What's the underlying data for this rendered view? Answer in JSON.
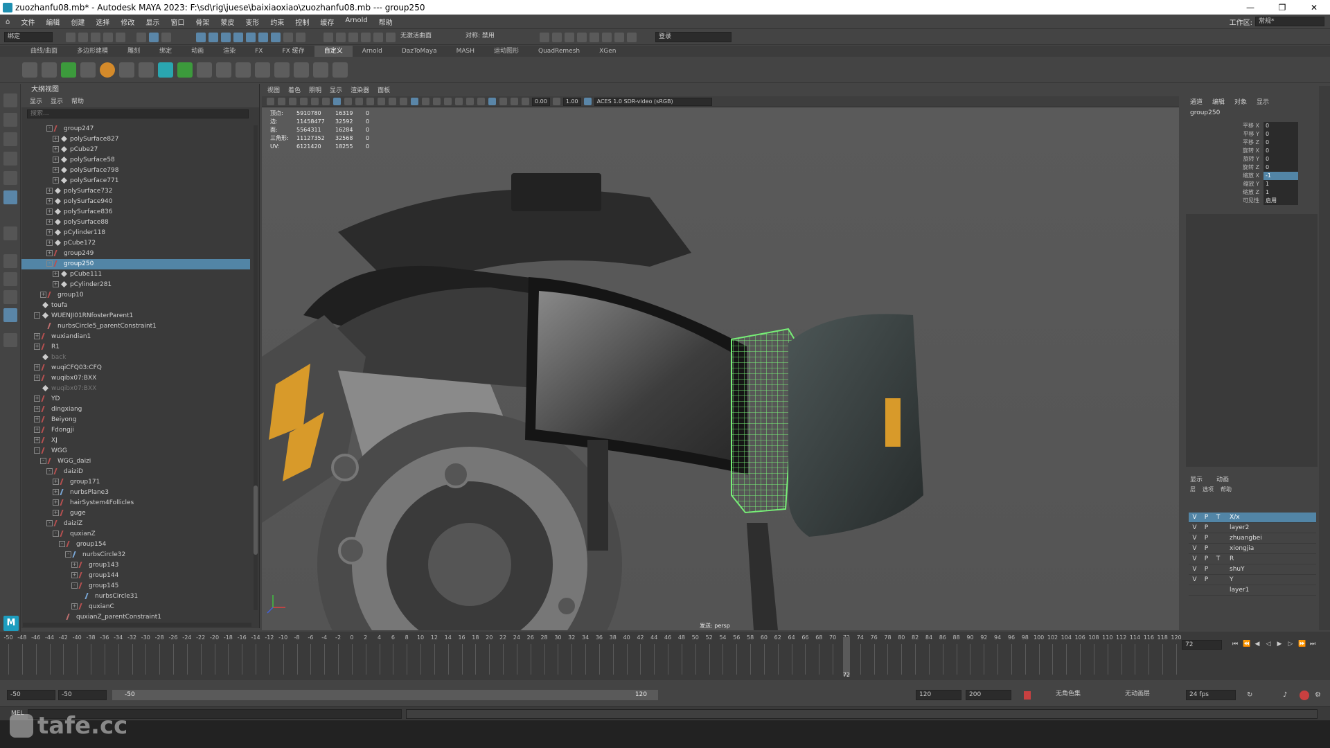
{
  "window": {
    "title": "zuozhanfu08.mb* - Autodesk MAYA 2023: F:\\sd\\rig\\juese\\baixiaoxiao\\zuozhanfu08.mb  ---  group250",
    "minimize": "—",
    "maximize": "❐",
    "close": "✕"
  },
  "menubar": {
    "items": [
      "文件",
      "编辑",
      "创建",
      "选择",
      "修改",
      "显示",
      "窗口",
      "骨架",
      "蒙皮",
      "变形",
      "约束",
      "控制",
      "缓存",
      "Arnold",
      "帮助"
    ],
    "workspace_label": "工作区:",
    "workspace_value": "常规*"
  },
  "statusline": {
    "mode": "绑定",
    "no_live_surface": "无激活曲面",
    "symmetry": "对称: 禁用",
    "login": "登录"
  },
  "shelf": {
    "tabs": [
      "曲线/曲面",
      "多边形建模",
      "雕刻",
      "绑定",
      "动画",
      "渲染",
      "FX",
      "FX 缓存",
      "自定义",
      "Arnold",
      "DazToMaya",
      "MASH",
      "运动图形",
      "QuadRemesh",
      "XGen"
    ],
    "active_tab": "自定义"
  },
  "outliner": {
    "title": "大纲视图",
    "menu": [
      "显示",
      "显示",
      "帮助"
    ],
    "search_placeholder": "搜索...",
    "items": [
      {
        "label": "group247",
        "depth": 4,
        "icon": "grp",
        "exp": "-"
      },
      {
        "label": "polySurface827",
        "depth": 5,
        "icon": "mesh",
        "exp": "+"
      },
      {
        "label": "pCube27",
        "depth": 5,
        "icon": "mesh",
        "exp": "+"
      },
      {
        "label": "polySurface58",
        "depth": 5,
        "icon": "mesh",
        "exp": "+"
      },
      {
        "label": "polySurface798",
        "depth": 5,
        "icon": "mesh",
        "exp": "+"
      },
      {
        "label": "polySurface771",
        "depth": 5,
        "icon": "mesh",
        "exp": "+"
      },
      {
        "label": "polySurface732",
        "depth": 4,
        "icon": "mesh",
        "exp": "+"
      },
      {
        "label": "polySurface940",
        "depth": 4,
        "icon": "mesh",
        "exp": "+"
      },
      {
        "label": "polySurface836",
        "depth": 4,
        "icon": "mesh",
        "exp": "+"
      },
      {
        "label": "polySurface88",
        "depth": 4,
        "icon": "mesh",
        "exp": "+"
      },
      {
        "label": "pCylinder118",
        "depth": 4,
        "icon": "mesh",
        "exp": "+"
      },
      {
        "label": "pCube172",
        "depth": 4,
        "icon": "mesh",
        "exp": "+"
      },
      {
        "label": "group249",
        "depth": 4,
        "icon": "grp",
        "exp": "+"
      },
      {
        "label": "group250",
        "depth": 4,
        "icon": "grp",
        "exp": "-",
        "selected": true
      },
      {
        "label": "pCube111",
        "depth": 5,
        "icon": "mesh",
        "exp": "+"
      },
      {
        "label": "pCylinder281",
        "depth": 5,
        "icon": "mesh",
        "exp": "+"
      },
      {
        "label": "group10",
        "depth": 3,
        "icon": "grp",
        "exp": "+"
      },
      {
        "label": "toufa",
        "depth": 2,
        "icon": "mesh",
        "exp": ""
      },
      {
        "label": "WUENJI01RNfosterParent1",
        "depth": 2,
        "icon": "mesh",
        "exp": "-"
      },
      {
        "label": "nurbsCircle5_parentConstraint1",
        "depth": 3,
        "icon": "constraint",
        "exp": ""
      },
      {
        "label": "wuxiandian1",
        "depth": 2,
        "icon": "grp",
        "exp": "+"
      },
      {
        "label": "R1",
        "depth": 2,
        "icon": "grp",
        "exp": "+"
      },
      {
        "label": "back",
        "depth": 2,
        "icon": "mesh",
        "exp": "",
        "dim": true
      },
      {
        "label": "wuqiCFQ03:CFQ",
        "depth": 2,
        "icon": "grp",
        "exp": "+"
      },
      {
        "label": "wuqibx07:BXX",
        "depth": 2,
        "icon": "grp",
        "exp": "+"
      },
      {
        "label": "wuqibx07:BXX",
        "depth": 2,
        "icon": "mesh",
        "exp": "",
        "dim": true
      },
      {
        "label": "YD",
        "depth": 2,
        "icon": "grp",
        "exp": "+"
      },
      {
        "label": "dingxiang",
        "depth": 2,
        "icon": "grp",
        "exp": "+"
      },
      {
        "label": "Beiyong",
        "depth": 2,
        "icon": "grp",
        "exp": "+"
      },
      {
        "label": "Fdongji",
        "depth": 2,
        "icon": "grp",
        "exp": "+"
      },
      {
        "label": "XJ",
        "depth": 2,
        "icon": "grp",
        "exp": "+"
      },
      {
        "label": "WGG",
        "depth": 2,
        "icon": "grp",
        "exp": "-"
      },
      {
        "label": "WGG_daizi",
        "depth": 3,
        "icon": "grp",
        "exp": "-"
      },
      {
        "label": "daiziD",
        "depth": 4,
        "icon": "grp",
        "exp": "-"
      },
      {
        "label": "group171",
        "depth": 5,
        "icon": "grp",
        "exp": "+"
      },
      {
        "label": "nurbsPlane3",
        "depth": 5,
        "icon": "curve",
        "exp": "+"
      },
      {
        "label": "hairSystem4Follicles",
        "depth": 5,
        "icon": "grp",
        "exp": "+"
      },
      {
        "label": "guge",
        "depth": 5,
        "icon": "grp",
        "exp": "+"
      },
      {
        "label": "daiziZ",
        "depth": 4,
        "icon": "grp",
        "exp": "-"
      },
      {
        "label": "quxianZ",
        "depth": 5,
        "icon": "grp",
        "exp": "-"
      },
      {
        "label": "group154",
        "depth": 6,
        "icon": "grp",
        "exp": "-"
      },
      {
        "label": "nurbsCircle32",
        "depth": 7,
        "icon": "curve",
        "exp": "-"
      },
      {
        "label": "group143",
        "depth": 8,
        "icon": "grp",
        "exp": "+"
      },
      {
        "label": "group144",
        "depth": 8,
        "icon": "grp",
        "exp": "+"
      },
      {
        "label": "group145",
        "depth": 8,
        "icon": "grp",
        "exp": "-"
      },
      {
        "label": "nurbsCircle31",
        "depth": 9,
        "icon": "curve",
        "exp": ""
      },
      {
        "label": "quxianC",
        "depth": 8,
        "icon": "grp",
        "exp": "+"
      },
      {
        "label": "quxianZ_parentConstraint1",
        "depth": 6,
        "icon": "constraint",
        "exp": ""
      }
    ]
  },
  "viewport": {
    "menu": [
      "视图",
      "着色",
      "照明",
      "显示",
      "渲染器",
      "面板"
    ],
    "field_a": "0.00",
    "field_b": "1.00",
    "color_space": "ACES 1.0 SDR-video (sRGB)",
    "hud": [
      {
        "label": "顶点:",
        "a": "5910780",
        "b": "16319",
        "c": "0"
      },
      {
        "label": "边:",
        "a": "11458477",
        "b": "32592",
        "c": "0"
      },
      {
        "label": "面:",
        "a": "5564311",
        "b": "16284",
        "c": "0"
      },
      {
        "label": "三角形:",
        "a": "11127352",
        "b": "32568",
        "c": "0"
      },
      {
        "label": "UV:",
        "a": "6121420",
        "b": "18255",
        "c": "0"
      }
    ],
    "camera_label": "发送: persp"
  },
  "channelbox": {
    "tabs": [
      "通道",
      "编辑",
      "对象",
      "显示"
    ],
    "node": "group250",
    "attrs": [
      {
        "name": "平移 X",
        "value": "0"
      },
      {
        "name": "平移 Y",
        "value": "0"
      },
      {
        "name": "平移 Z",
        "value": "0"
      },
      {
        "name": "旋转 X",
        "value": "0"
      },
      {
        "name": "旋转 Y",
        "value": "0"
      },
      {
        "name": "旋转 Z",
        "value": "0"
      },
      {
        "name": "缩放 X",
        "value": "-1",
        "hl": true
      },
      {
        "name": "缩放 Y",
        "value": "1"
      },
      {
        "name": "缩放 Z",
        "value": "1"
      },
      {
        "name": "可见性",
        "value": "启用"
      }
    ]
  },
  "layers": {
    "tabs": [
      "显示",
      "动画"
    ],
    "menu": [
      "层",
      "选项",
      "帮助"
    ],
    "items": [
      {
        "v": "V",
        "p": "P",
        "t": "T",
        "name": "X/x",
        "hl": true
      },
      {
        "v": "V",
        "p": "P",
        "t": "",
        "name": "layer2"
      },
      {
        "v": "V",
        "p": "P",
        "t": "",
        "name": "zhuangbei"
      },
      {
        "v": "V",
        "p": "P",
        "t": "",
        "name": "xiongjia"
      },
      {
        "v": "V",
        "p": "P",
        "t": "T",
        "name": "R"
      },
      {
        "v": "V",
        "p": "P",
        "t": "",
        "name": "shuY"
      },
      {
        "v": "V",
        "p": "P",
        "t": "",
        "name": "Y"
      },
      {
        "v": "",
        "p": "",
        "t": "",
        "name": "layer1"
      }
    ]
  },
  "timeslider": {
    "current_frame": "72",
    "frame_field": "72",
    "start": -50,
    "end": 120,
    "step": 2,
    "cursor_frame": 72
  },
  "range": {
    "anim_start": "-50",
    "play_start": "-50",
    "range_start": "-50",
    "range_end": "120",
    "play_end": "120",
    "anim_end": "200",
    "char_set": "无角色集",
    "anim_layer": "无动画层",
    "fps": "24 fps"
  },
  "cmdline": {
    "mel": "MEL"
  },
  "watermark": "tafe.cc"
}
